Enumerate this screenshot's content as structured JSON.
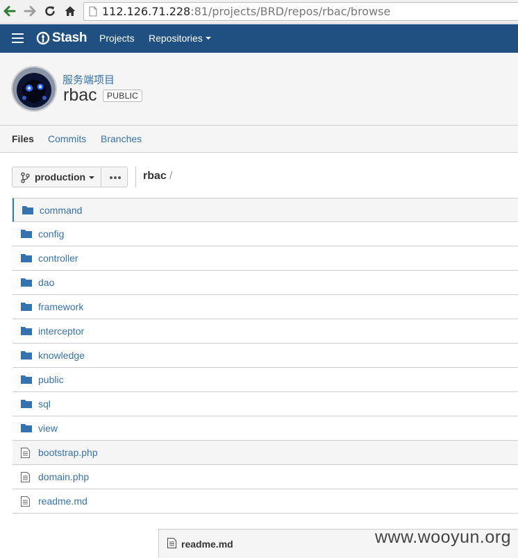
{
  "browser": {
    "url_host": "112.126.71.228",
    "url_rest": ":81/projects/BRD/repos/rbac/browse",
    "icons": [
      "back-arrow-icon",
      "forward-arrow-icon",
      "reload-icon",
      "home-icon",
      "page-icon"
    ]
  },
  "header": {
    "logo_text": "Stash",
    "nav": [
      "Projects",
      "Repositories"
    ],
    "accent": "#205081"
  },
  "repo": {
    "project_name": "服务端项目",
    "name": "rbac",
    "visibility": "PUBLIC"
  },
  "tabs": [
    "Files",
    "Commits",
    "Branches"
  ],
  "toolbar": {
    "branch": "production",
    "breadcrumb": "rbac",
    "breadcrumb_sep": "/"
  },
  "files": [
    {
      "name": "command",
      "type": "folder"
    },
    {
      "name": "config",
      "type": "folder"
    },
    {
      "name": "controller",
      "type": "folder"
    },
    {
      "name": "dao",
      "type": "folder"
    },
    {
      "name": "framework",
      "type": "folder"
    },
    {
      "name": "interceptor",
      "type": "folder"
    },
    {
      "name": "knowledge",
      "type": "folder"
    },
    {
      "name": "public",
      "type": "folder"
    },
    {
      "name": "sql",
      "type": "folder"
    },
    {
      "name": "view",
      "type": "folder"
    },
    {
      "name": "bootstrap.php",
      "type": "file"
    },
    {
      "name": "domain.php",
      "type": "file"
    },
    {
      "name": "readme.md",
      "type": "file"
    }
  ],
  "readme": {
    "title": "readme.md"
  },
  "watermark": "www.wooyun.org",
  "colors": {
    "link": "#3572b0",
    "folder": "#3572b0"
  }
}
